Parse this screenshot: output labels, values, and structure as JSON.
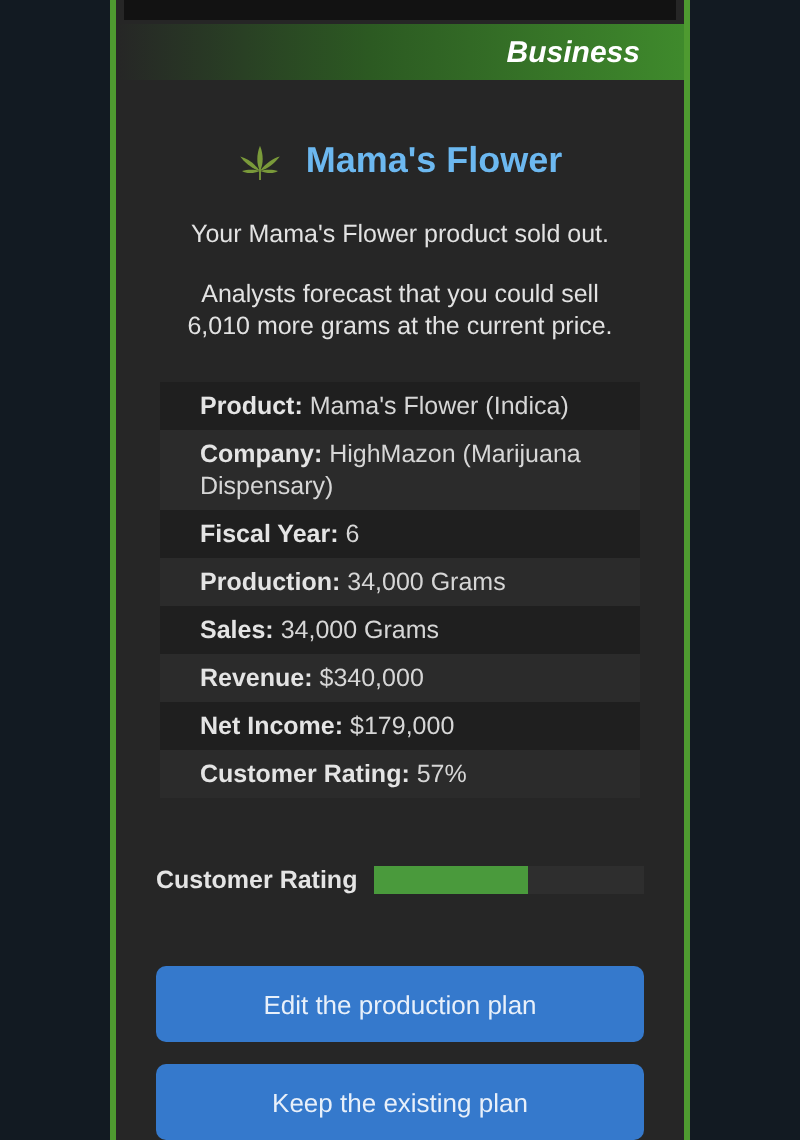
{
  "dialog": {
    "category": "Business",
    "title": "Mama's Flower",
    "message": "Your Mama's Flower product sold out.",
    "forecast": "Analysts forecast that you could sell 6,010 more grams at the current price.",
    "details": [
      {
        "label": "Product:",
        "value": "Mama's Flower (Indica)"
      },
      {
        "label": "Company:",
        "value": "HighMazon (Marijuana Dispensary)"
      },
      {
        "label": "Fiscal Year:",
        "value": "6"
      },
      {
        "label": "Production:",
        "value": "34,000 Grams"
      },
      {
        "label": "Sales:",
        "value": "34,000 Grams"
      },
      {
        "label": "Revenue:",
        "value": "$340,000"
      },
      {
        "label": "Net Income:",
        "value": "$179,000"
      },
      {
        "label": "Customer Rating:",
        "value": "57%"
      }
    ],
    "rating": {
      "label": "Customer Rating",
      "level": 0.57
    },
    "buttons": [
      "Edit the production plan",
      "Keep the existing plan"
    ]
  }
}
